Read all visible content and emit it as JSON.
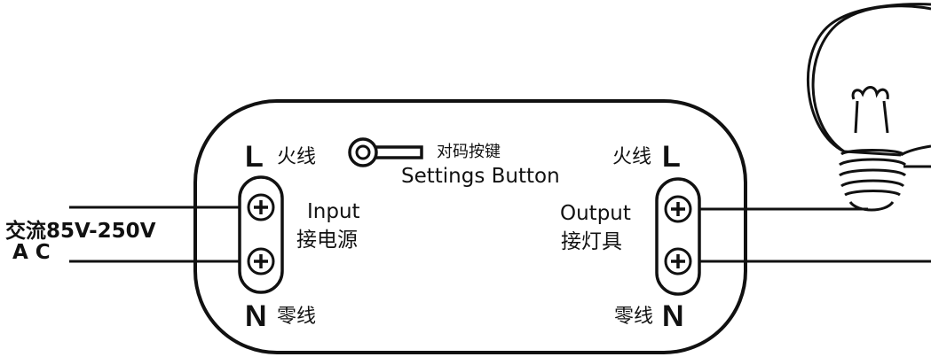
{
  "left_terminal": {
    "live_letter": "L",
    "live_cn": "火线",
    "neutral_letter": "N",
    "neutral_cn": "零线",
    "label_en": "Input",
    "label_cn": "接电源"
  },
  "right_terminal": {
    "live_letter": "L",
    "live_cn": "火线",
    "neutral_letter": "N",
    "neutral_cn": "零线",
    "label_en": "Output",
    "label_cn": "接灯具"
  },
  "settings_button": {
    "label_cn": "对码按键",
    "label_en": "Settings Button"
  },
  "supply": {
    "line1": "交流85V-250V",
    "line2": "A C"
  }
}
